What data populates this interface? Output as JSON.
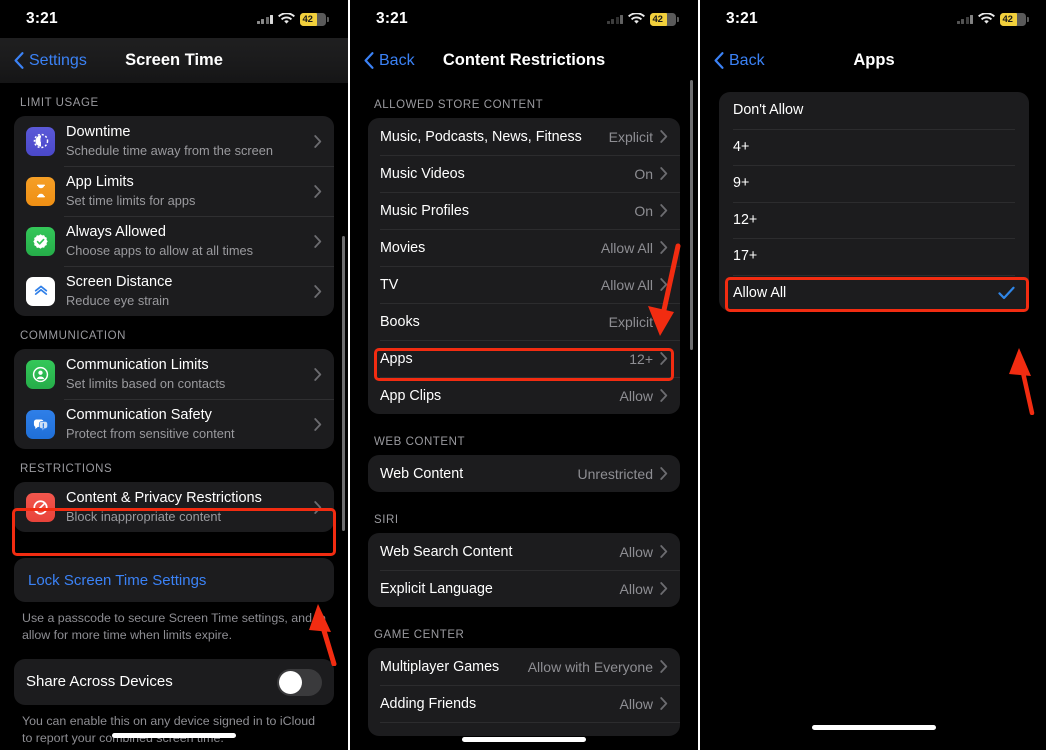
{
  "meta": {
    "accent_red": "#f22c11",
    "ios_blue": "#3b82f6",
    "gray_value": "#8e8e93"
  },
  "status_bar": {
    "time": "3:21",
    "battery_percent": "42",
    "wifi_icon": "wifi-icon",
    "signal_icon": "cellular-signal-icon"
  },
  "panel1": {
    "nav": {
      "back_label": "Settings",
      "title": "Screen Time"
    },
    "sections": [
      {
        "header": "LIMIT USAGE",
        "rows": [
          {
            "icon": "downtime-icon",
            "title": "Downtime",
            "subtitle": "Schedule time away from the screen"
          },
          {
            "icon": "app-limits-icon",
            "title": "App Limits",
            "subtitle": "Set time limits for apps"
          },
          {
            "icon": "always-allowed-icon",
            "title": "Always Allowed",
            "subtitle": "Choose apps to allow at all times"
          },
          {
            "icon": "screen-distance-icon",
            "title": "Screen Distance",
            "subtitle": "Reduce eye strain"
          }
        ]
      },
      {
        "header": "COMMUNICATION",
        "rows": [
          {
            "icon": "communication-limits-icon",
            "title": "Communication Limits",
            "subtitle": "Set limits based on contacts"
          },
          {
            "icon": "communication-safety-icon",
            "title": "Communication Safety",
            "subtitle": "Protect from sensitive content"
          }
        ]
      },
      {
        "header": "RESTRICTIONS",
        "rows": [
          {
            "icon": "content-privacy-icon",
            "title": "Content & Privacy Restrictions",
            "subtitle": "Block inappropriate content"
          }
        ]
      }
    ],
    "lock_link": "Lock Screen Time Settings",
    "lock_footnote": "Use a passcode to secure Screen Time settings, and to allow for more time when limits expire.",
    "share_row": {
      "title": "Share Across Devices",
      "toggle_on": false
    },
    "share_footnote": "You can enable this on any device signed in to iCloud to report your combined screen time."
  },
  "panel2": {
    "nav": {
      "back_label": "Back",
      "title": "Content Restrictions"
    },
    "sections": [
      {
        "header": "ALLOWED STORE CONTENT",
        "rows": [
          {
            "title": "Music, Podcasts, News, Fitness",
            "value": "Explicit"
          },
          {
            "title": "Music Videos",
            "value": "On"
          },
          {
            "title": "Music Profiles",
            "value": "On"
          },
          {
            "title": "Movies",
            "value": "Allow All"
          },
          {
            "title": "TV",
            "value": "Allow All"
          },
          {
            "title": "Books",
            "value": "Explicit"
          },
          {
            "title": "Apps",
            "value": "12+",
            "highlighted": true
          },
          {
            "title": "App Clips",
            "value": "Allow"
          }
        ]
      },
      {
        "header": "WEB CONTENT",
        "rows": [
          {
            "title": "Web Content",
            "value": "Unrestricted"
          }
        ]
      },
      {
        "header": "SIRI",
        "rows": [
          {
            "title": "Web Search Content",
            "value": "Allow"
          },
          {
            "title": "Explicit Language",
            "value": "Allow"
          }
        ]
      },
      {
        "header": "GAME CENTER",
        "rows": [
          {
            "title": "Multiplayer Games",
            "value": "Allow with Everyone"
          },
          {
            "title": "Adding Friends",
            "value": "Allow"
          }
        ]
      }
    ]
  },
  "panel3": {
    "nav": {
      "back_label": "Back",
      "title": "Apps"
    },
    "options": [
      {
        "label": "Don't Allow",
        "selected": false
      },
      {
        "label": "4+",
        "selected": false
      },
      {
        "label": "9+",
        "selected": false
      },
      {
        "label": "12+",
        "selected": false
      },
      {
        "label": "17+",
        "selected": false
      },
      {
        "label": "Allow All",
        "selected": true,
        "highlighted": true
      }
    ]
  }
}
